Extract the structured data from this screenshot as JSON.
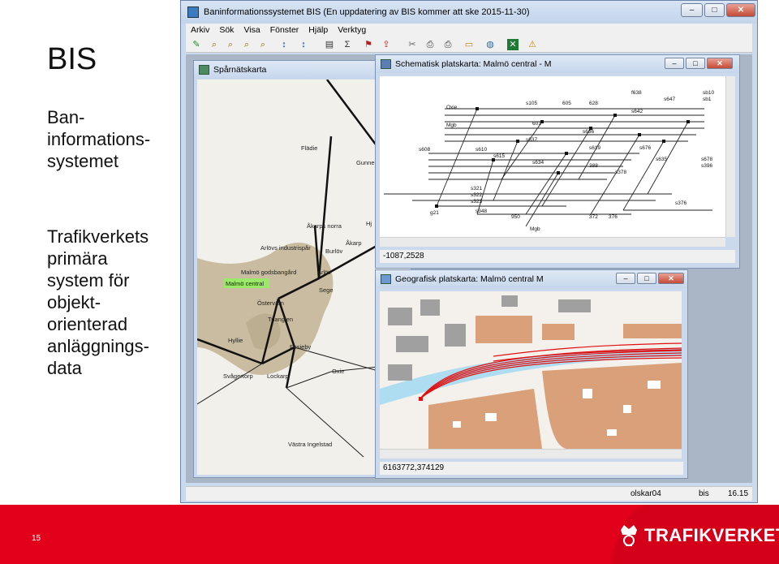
{
  "slide": {
    "title": "BIS",
    "description": "Ban-\ninformations-\nsystemet",
    "bullet": "Trafikverkets\nprimära\nsystem för\nobjekt-\norienterad\nanläggnings-\ndata",
    "page_number": "15",
    "logo_text": "TRAFIKVERKET"
  },
  "app": {
    "title": "Baninformationssystemet BIS    (En uppdatering av BIS kommer att ske 2015-11-30)",
    "window_buttons": [
      "–",
      "□",
      "✕"
    ],
    "menu": [
      "Arkiv",
      "Sök",
      "Visa",
      "Fönster",
      "Hjälp",
      "Verktyg"
    ],
    "toolbar_icons": [
      "pencil-icon",
      "zoom-icon",
      "zoom-in-icon",
      "zoom-out-icon",
      "zoom-select-icon",
      "sort-icon",
      "map-icon",
      "sigma-icon",
      "flag-icon",
      "export-icon",
      "cut-icon",
      "print-icon",
      "print-preview-icon",
      "folder-icon",
      "globe-icon",
      "excel-icon",
      "warning-icon"
    ],
    "status": {
      "user": "olskar04",
      "system": "bis",
      "version": "16.15"
    }
  },
  "spar_window": {
    "title": "Spårnätskarta",
    "places": [
      "Flädie",
      "Gunne",
      "Åkarps norra",
      "Åkarp",
      "Arlövs industrispår",
      "Burlöv",
      "Malmö godsbangård",
      "Arlöv",
      "Malmö central",
      "Sege",
      "Östervärn",
      "Trianglen",
      "Hyllie",
      "Fosieby",
      "Svågertorp",
      "Lockarp",
      "Oxie",
      "Västra Ingelstad",
      "Hj"
    ]
  },
  "schematic_window": {
    "title": "Schematisk platskarta: Malmö central - M",
    "coords": "-1087,2528",
    "labels": [
      "s105",
      "605",
      "628",
      "f638",
      "sb10",
      "sb1",
      "s647",
      "s642",
      "601",
      "s636",
      "s619",
      "s676",
      "Oxie",
      "Mgb",
      "s608",
      "s610",
      "s615",
      "s637",
      "s634",
      "388",
      "s378",
      "s376",
      "s321",
      "s322",
      "s323",
      "s348",
      "950",
      "372",
      "376",
      "Mgb",
      "g21",
      "s396",
      "s678",
      "s635"
    ]
  },
  "geo_window": {
    "title": "Geografisk platskarta: Malmö central  M",
    "coords": "6163772,374129"
  },
  "colors": {
    "footer_red": "#e2001a",
    "map_land": "#c9bca0",
    "geo_building": "#d9a07a",
    "highlight": "#9be86a"
  }
}
